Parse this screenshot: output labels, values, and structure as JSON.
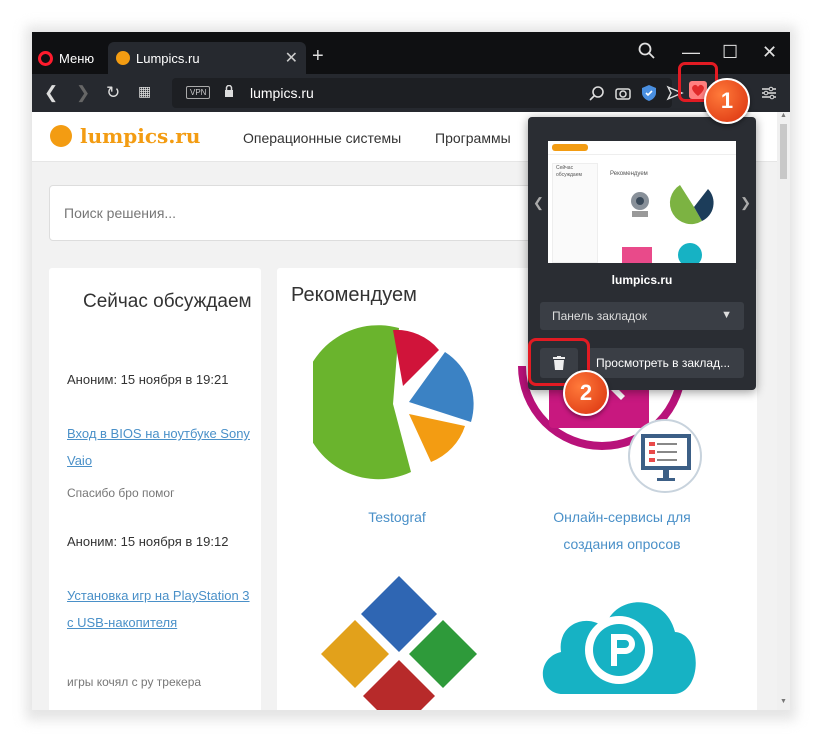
{
  "browser": {
    "menu_label": "Меню",
    "tab_title": "Lumpics.ru",
    "url": "lumpics.ru",
    "vpn_label": "VPN"
  },
  "site": {
    "logo": "lumpics.ru",
    "nav": [
      "Операционные системы",
      "Программы"
    ],
    "search_placeholder": "Поиск решения..."
  },
  "discuss": {
    "heading": "Сейчас обсуждаем",
    "comments": [
      {
        "meta": "Аноним: 15 ноября в 19:21",
        "link": "Вход в BIOS на ноутбуке Sony Vaio",
        "text": "Спасибо бро помог"
      },
      {
        "meta": "Аноним: 15 ноября в 19:12",
        "link": "Установка игр на PlayStation 3 с USB-накопителя",
        "text": "игры кочял с ру трекера"
      }
    ]
  },
  "recommend": {
    "heading": "Рекомендуем",
    "items": [
      "Testograf",
      "Онлайн-сервисы для создания опросов"
    ]
  },
  "popup": {
    "site_title": "lumpics.ru",
    "thumb_title": "Сейчас обсуждаем",
    "thumb_rec": "Рекомендуем",
    "folder": "Панель закладок",
    "view_button": "Просмотреть в заклад..."
  },
  "badges": [
    "1",
    "2"
  ],
  "colors": {
    "opera_red": "#ff1b2d",
    "brand_orange": "#f39c12",
    "link_blue": "#4a90c8",
    "highlight_red": "#e21b23"
  }
}
